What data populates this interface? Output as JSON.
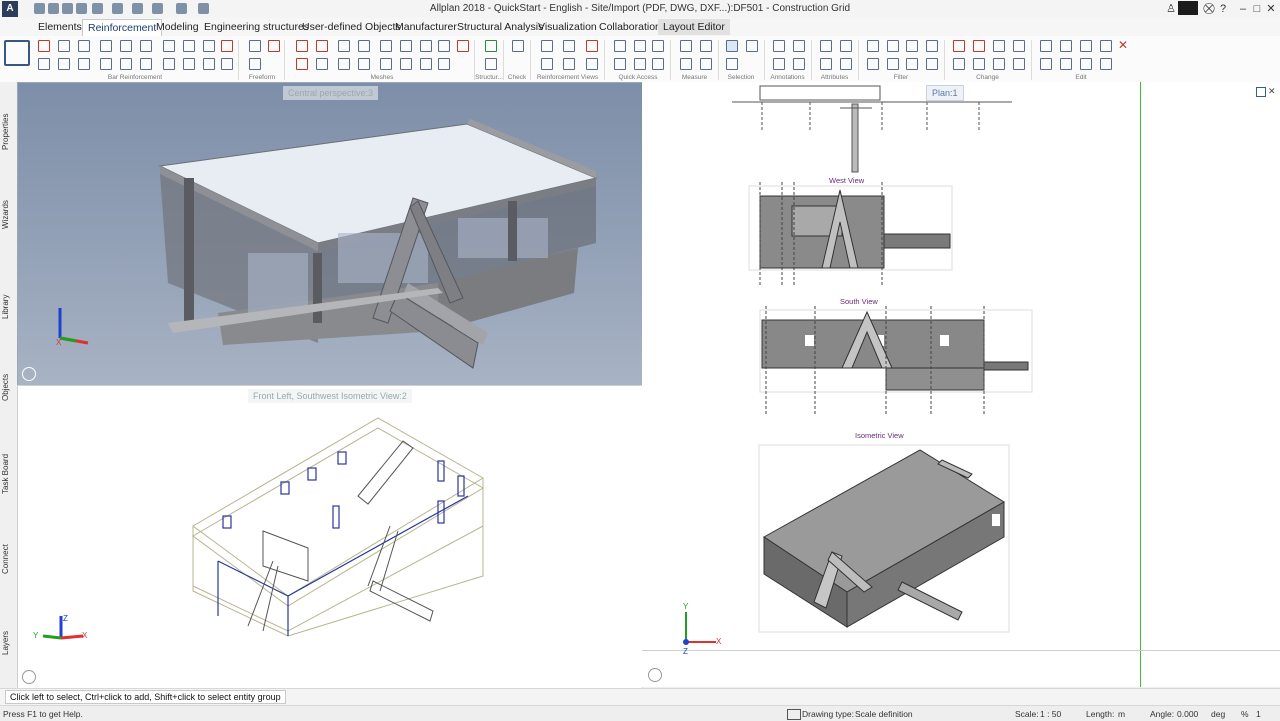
{
  "window": {
    "title": "Allplan 2018 - QuickStart - English - Site/Import (PDF, DWG, DXF...):DF501 - Construction Grid"
  },
  "menu": {
    "tabs": [
      {
        "label": "Elements"
      },
      {
        "label": "Reinforcement"
      },
      {
        "label": "Modeling"
      },
      {
        "label": "Engineering structures"
      },
      {
        "label": "User-defined Objects"
      },
      {
        "label": "Manufacturer"
      },
      {
        "label": "Structural Analysis"
      },
      {
        "label": "Visualization"
      },
      {
        "label": "Collaboration"
      },
      {
        "label": "Layout Editor"
      }
    ],
    "active_tab": "Reinforcement"
  },
  "ribbon": {
    "groups": [
      {
        "label": "Bar Reinforcement"
      },
      {
        "label": "Freeform"
      },
      {
        "label": "Meshes"
      },
      {
        "label": "Structur..."
      },
      {
        "label": "Check"
      },
      {
        "label": "Reinforcement Views"
      },
      {
        "label": "Quick Access"
      },
      {
        "label": "Measure"
      },
      {
        "label": "Selection"
      },
      {
        "label": "Annotations"
      },
      {
        "label": "Attributes"
      },
      {
        "label": "Filter"
      },
      {
        "label": "Change"
      },
      {
        "label": "Edit"
      }
    ]
  },
  "left_dock": {
    "tabs": [
      {
        "label": "Properties"
      },
      {
        "label": "Wizards"
      },
      {
        "label": "Library"
      },
      {
        "label": "Objects"
      },
      {
        "label": "Task Board"
      },
      {
        "label": "Connect"
      },
      {
        "label": "Layers"
      }
    ]
  },
  "viewports": {
    "top_left": {
      "label": "Central perspective:3"
    },
    "bottom_left": {
      "label": "Front Left, Southwest Isometric View:2"
    },
    "right": {
      "label": "Plan:1",
      "views": [
        {
          "label": "West View"
        },
        {
          "label": "South View"
        },
        {
          "label": "Isometric View"
        }
      ]
    }
  },
  "axes": {
    "x": "X",
    "y": "Y",
    "z": "Z"
  },
  "colors": {
    "accent": "#1c3d6e",
    "viewport_bg": "#8a9ab1",
    "red_axis": "#e03030",
    "green_axis": "#20a020",
    "blue_axis": "#2040d0",
    "view_title": "#6a2a7a"
  },
  "prompt": {
    "text": "Click left to select, Ctrl+click to add, Shift+click to select entity group"
  },
  "status": {
    "help": "Press F1 to get Help.",
    "drawing_type_label": "Drawing type:",
    "drawing_type_value": "Scale definition",
    "scale_label": "Scale:",
    "scale_value": "1 : 50",
    "length_label": "Length:",
    "length_value": "m",
    "angle_label": "Angle:",
    "angle_value": "0.000",
    "angle_unit": "deg",
    "percent": "%",
    "percent_value": "1"
  }
}
